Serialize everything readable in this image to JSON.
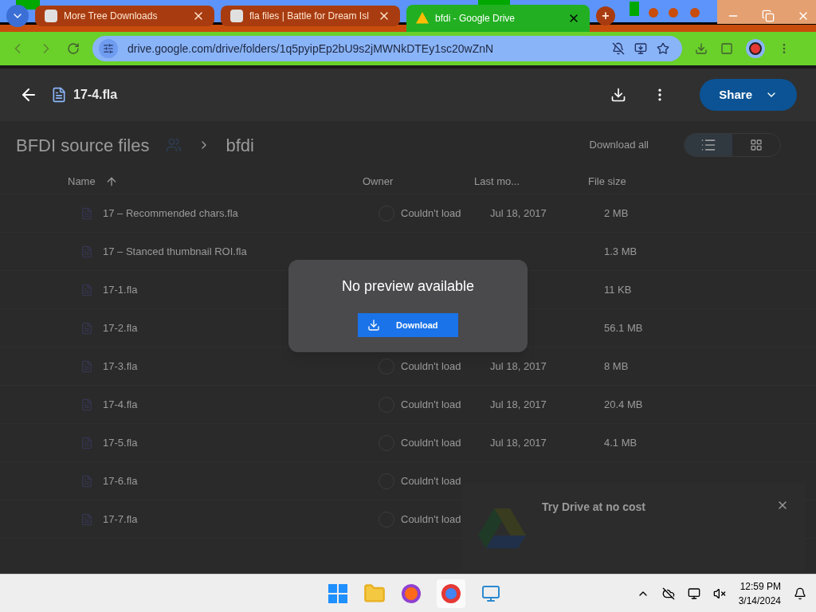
{
  "browser": {
    "tabs": [
      {
        "title": "More Tree Downloads",
        "selected": false
      },
      {
        "title": "fla files | Battle for Dream Isl",
        "selected": false
      },
      {
        "title": "bfdi - Google Drive",
        "selected": true
      }
    ],
    "new_tab": "+",
    "url": "drive.google.com/drive/folders/1q5pyipEp2bU9s2jMWNkDTEy1sc20wZnN"
  },
  "viewer": {
    "file_name": "17-4.fla",
    "share": "Share"
  },
  "drive": {
    "breadcrumbs": [
      "BFDI source files",
      "bfdi"
    ],
    "download_all": "Download all",
    "columns": [
      "Name",
      "Owner",
      "Last mo...",
      "File size"
    ],
    "rows": [
      {
        "name": "17 – Recommended chars.fla",
        "owner": "Couldn't load",
        "modified": "Jul 18, 2017",
        "size": "2 MB"
      },
      {
        "name": "17 – Stanced thumbnail ROI.fla",
        "size": "1.3 MB"
      },
      {
        "name": "17-1.fla",
        "size": "11 KB"
      },
      {
        "name": "17-2.fla",
        "size": "56.1 MB"
      },
      {
        "name": "17-3.fla",
        "owner": "Couldn't load",
        "modified": "Jul 18, 2017",
        "size": "8 MB"
      },
      {
        "name": "17-4.fla",
        "owner": "Couldn't load",
        "modified": "Jul 18, 2017",
        "size": "20.4 MB"
      },
      {
        "name": "17-5.fla",
        "owner": "Couldn't load",
        "modified": "Jul 18, 2017",
        "size": "4.1 MB"
      },
      {
        "name": "17-6.fla",
        "owner": "Couldn't load"
      },
      {
        "name": "17-7.fla",
        "owner": "Couldn't load"
      }
    ],
    "promo": {
      "title": "Try Drive at no cost"
    }
  },
  "dialog": {
    "message": "No preview available",
    "button": "Download"
  },
  "taskbar": {
    "time": "12:59 PM",
    "date": "3/14/2024"
  }
}
